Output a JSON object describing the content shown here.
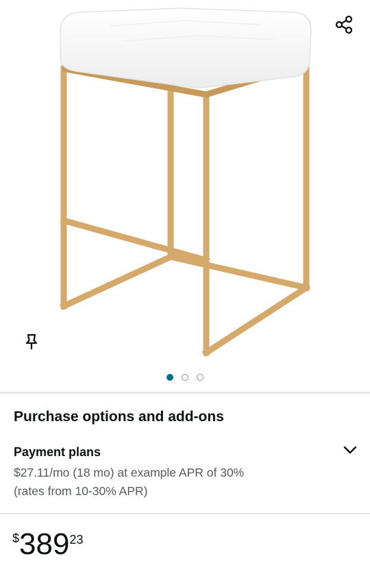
{
  "gallery": {
    "image_subject": "white upholstered counter stool with brushed gold frame",
    "icons": {
      "share": "share-icon",
      "pin": "pin-icon"
    },
    "dots": [
      {
        "active": true
      },
      {
        "active": false
      },
      {
        "active": false
      }
    ],
    "colors": {
      "dot_active": "#007185",
      "frame": "#d4a96a",
      "seat": "#ffffff"
    }
  },
  "purchase": {
    "title": "Purchase options and add-ons",
    "payment_plans": {
      "label": "Payment plans",
      "line1": "$27.11/mo (18 mo) at example APR of 30%",
      "line2": "(rates from 10-30% APR)",
      "icon": "chevron-down-icon"
    }
  },
  "price": {
    "symbol": "$",
    "whole": "389",
    "fraction": "23"
  }
}
